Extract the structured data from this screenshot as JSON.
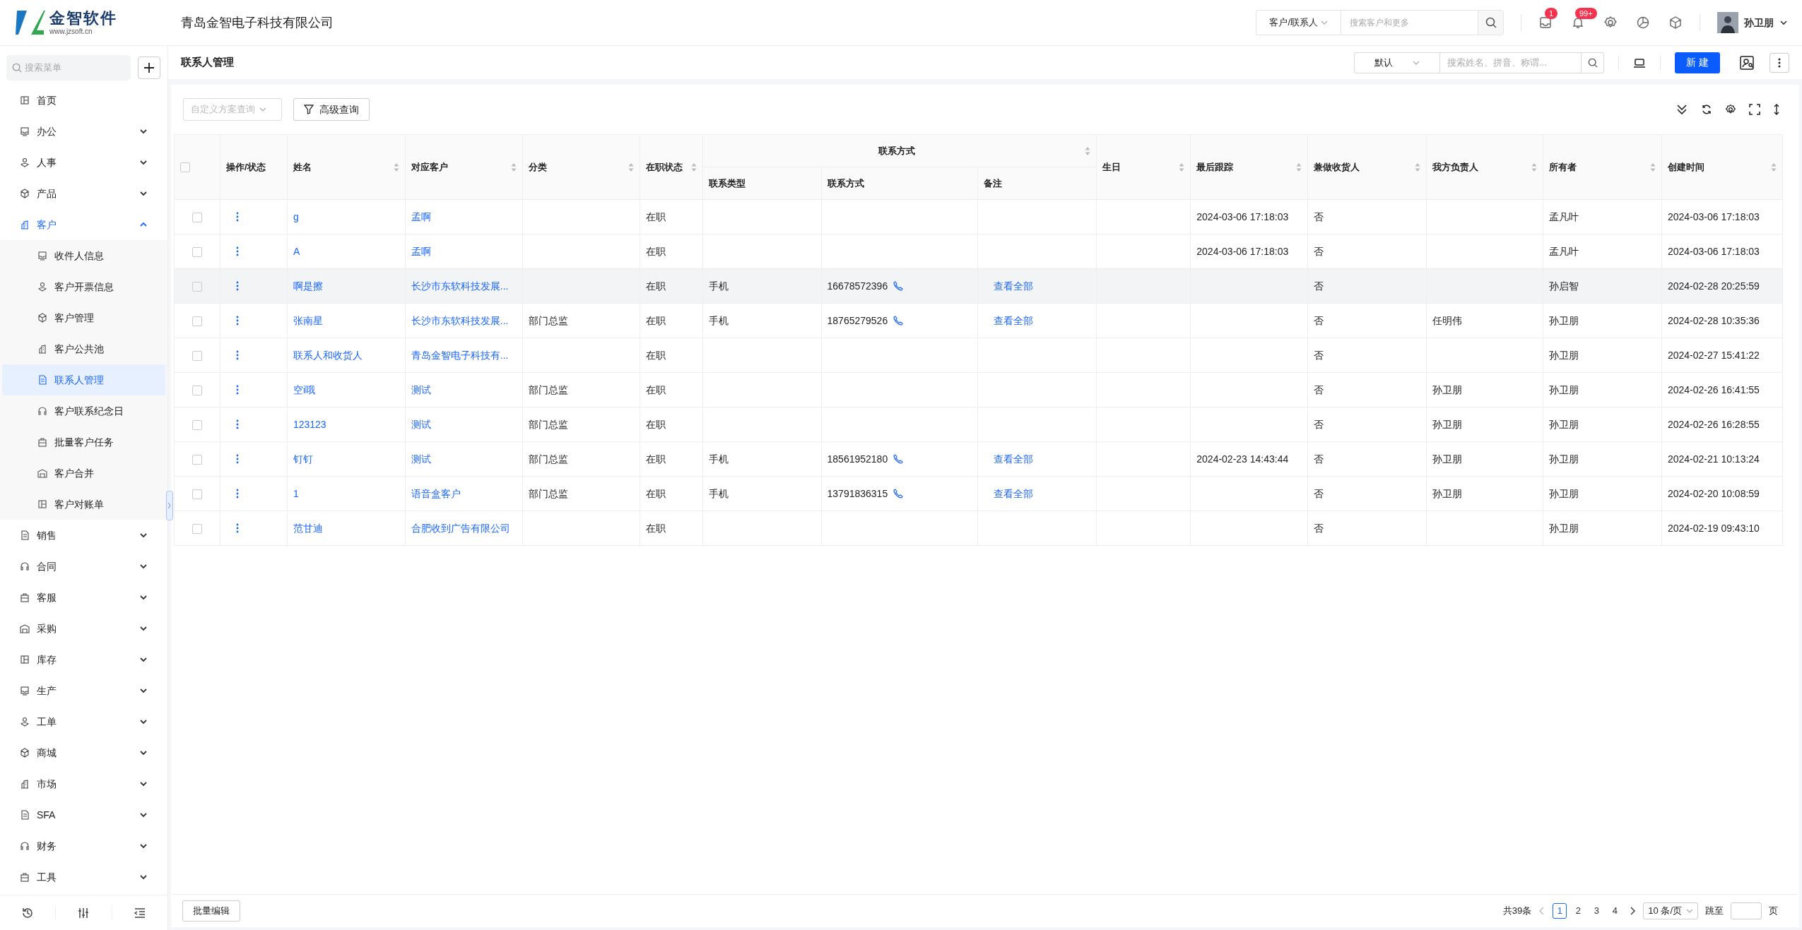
{
  "app": {
    "logo_name": "金智软件",
    "logo_url": "www.jzsoft.cn",
    "company": "青岛金智电子科技有限公司"
  },
  "topbar": {
    "search_scope": "客户/联系人",
    "search_placeholder": "搜索客户和更多",
    "message_count": "1",
    "notice_count": "99+",
    "user": "孙卫朋"
  },
  "sidebar": {
    "search_placeholder": "搜索菜单",
    "items": [
      {
        "label": "首页",
        "kind": "link"
      },
      {
        "label": "办公",
        "kind": "group",
        "expanded": false
      },
      {
        "label": "人事",
        "kind": "group",
        "expanded": false
      },
      {
        "label": "产品",
        "kind": "group",
        "expanded": false
      },
      {
        "label": "客户",
        "kind": "group",
        "expanded": true,
        "children": [
          {
            "label": "收件人信息",
            "selected": false
          },
          {
            "label": "客户开票信息",
            "selected": false
          },
          {
            "label": "客户管理",
            "selected": false
          },
          {
            "label": "客户公共池",
            "selected": false
          },
          {
            "label": "联系人管理",
            "selected": true
          },
          {
            "label": "客户联系纪念日",
            "selected": false
          },
          {
            "label": "批量客户任务",
            "selected": false
          },
          {
            "label": "客户合并",
            "selected": false
          },
          {
            "label": "客户对账单",
            "selected": false
          }
        ]
      },
      {
        "label": "销售",
        "kind": "group",
        "expanded": false
      },
      {
        "label": "合同",
        "kind": "group",
        "expanded": false
      },
      {
        "label": "客服",
        "kind": "group",
        "expanded": false
      },
      {
        "label": "采购",
        "kind": "group",
        "expanded": false
      },
      {
        "label": "库存",
        "kind": "group",
        "expanded": false
      },
      {
        "label": "生产",
        "kind": "group",
        "expanded": false
      },
      {
        "label": "工单",
        "kind": "group",
        "expanded": false
      },
      {
        "label": "商城",
        "kind": "group",
        "expanded": false
      },
      {
        "label": "市场",
        "kind": "group",
        "expanded": false
      },
      {
        "label": "SFA",
        "kind": "group",
        "expanded": false
      },
      {
        "label": "财务",
        "kind": "group",
        "expanded": false
      },
      {
        "label": "工具",
        "kind": "group",
        "expanded": false
      }
    ]
  },
  "page": {
    "title": "联系人管理",
    "view_select": "默认",
    "search_placeholder": "搜索姓名、拼音、称谓...",
    "new_button": "新 建"
  },
  "toolbar": {
    "scheme_placeholder": "自定义方案查询",
    "advanced_button": "高级查询"
  },
  "table": {
    "all_selected": false,
    "columns": [
      {
        "label": "操作/状态",
        "sortable": false
      },
      {
        "label": "姓名",
        "sortable": true
      },
      {
        "label": "对应客户",
        "sortable": true
      },
      {
        "label": "分类",
        "sortable": true
      },
      {
        "label": "在职状态",
        "sortable": true
      },
      {
        "label": "联系方式",
        "sortable": true,
        "children": [
          {
            "label": "联系类型"
          },
          {
            "label": "联系方式"
          },
          {
            "label": "备注"
          }
        ]
      },
      {
        "label": "生日",
        "sortable": true
      },
      {
        "label": "最后跟踪",
        "sortable": true
      },
      {
        "label": "兼做收货人",
        "sortable": true
      },
      {
        "label": "我方负责人",
        "sortable": true
      },
      {
        "label": "所有者",
        "sortable": true
      },
      {
        "label": "创建时间",
        "sortable": true
      }
    ],
    "rows": [
      {
        "selected": false,
        "hovered": false,
        "name": "g",
        "customer": "孟啊",
        "status": "在职",
        "last_follow": "2024-03-06 17:18:03",
        "receiver": "否",
        "owner": "孟凡叶",
        "created": "2024-03-06 17:18:03"
      },
      {
        "selected": false,
        "hovered": false,
        "name": "A",
        "customer": "孟啊",
        "status": "在职",
        "last_follow": "2024-03-06 17:18:03",
        "receiver": "否",
        "owner": "孟凡叶",
        "created": "2024-03-06 17:18:03"
      },
      {
        "selected": false,
        "hovered": true,
        "name": "啊是擦",
        "customer": "长沙市东软科技发展...",
        "status": "在职",
        "contact_type": "手机",
        "phone": "16678572396",
        "note": "查看全部",
        "receiver": "否",
        "owner": "孙启智",
        "created": "2024-02-28 20:25:59"
      },
      {
        "selected": false,
        "hovered": false,
        "name": "张南星",
        "customer": "长沙市东软科技发展...",
        "category": "部门总监",
        "status": "在职",
        "contact_type": "手机",
        "phone": "18765279526",
        "note": "查看全部",
        "receiver": "否",
        "rep": "任明伟",
        "owner": "孙卫朋",
        "created": "2024-02-28 10:35:36"
      },
      {
        "selected": false,
        "hovered": false,
        "name": "联系人和收货人",
        "customer": "青岛金智电子科技有...",
        "status": "在职",
        "receiver": "否",
        "owner": "孙卫朋",
        "created": "2024-02-27 15:41:22"
      },
      {
        "selected": false,
        "hovered": false,
        "name": "空i哦",
        "customer": "测试",
        "category": "部门总监",
        "status": "在职",
        "receiver": "否",
        "rep": "孙卫朋",
        "owner": "孙卫朋",
        "created": "2024-02-26 16:41:55"
      },
      {
        "selected": false,
        "hovered": false,
        "name": "123123",
        "customer": "测试",
        "category": "部门总监",
        "status": "在职",
        "receiver": "否",
        "rep": "孙卫朋",
        "owner": "孙卫朋",
        "created": "2024-02-26 16:28:55"
      },
      {
        "selected": false,
        "hovered": false,
        "name": "钉钉",
        "customer": "测试",
        "category": "部门总监",
        "status": "在职",
        "contact_type": "手机",
        "phone": "18561952180",
        "note": "查看全部",
        "last_follow": "2024-02-23 14:43:44",
        "receiver": "否",
        "rep": "孙卫朋",
        "owner": "孙卫朋",
        "created": "2024-02-21 10:13:24"
      },
      {
        "selected": false,
        "hovered": false,
        "name": "1",
        "customer": "语音盒客户",
        "category": "部门总监",
        "status": "在职",
        "contact_type": "手机",
        "phone": "13791836315",
        "note": "查看全部",
        "receiver": "否",
        "rep": "孙卫朋",
        "owner": "孙卫朋",
        "created": "2024-02-20 10:08:59"
      },
      {
        "selected": false,
        "hovered": false,
        "name": "范甘迪",
        "customer": "合肥收到广告有限公司",
        "status": "在职",
        "receiver": "否",
        "owner": "孙卫朋",
        "created": "2024-02-19 09:43:10"
      }
    ]
  },
  "footer": {
    "batch_edit": "批量编辑",
    "total": "共39条",
    "pages": [
      {
        "label": "1",
        "selected": true
      },
      {
        "label": "2",
        "selected": false
      },
      {
        "label": "3",
        "selected": false
      },
      {
        "label": "4",
        "selected": false
      }
    ],
    "page_size": "10 条/页",
    "jump_label": "跳至",
    "page_unit": "页"
  }
}
